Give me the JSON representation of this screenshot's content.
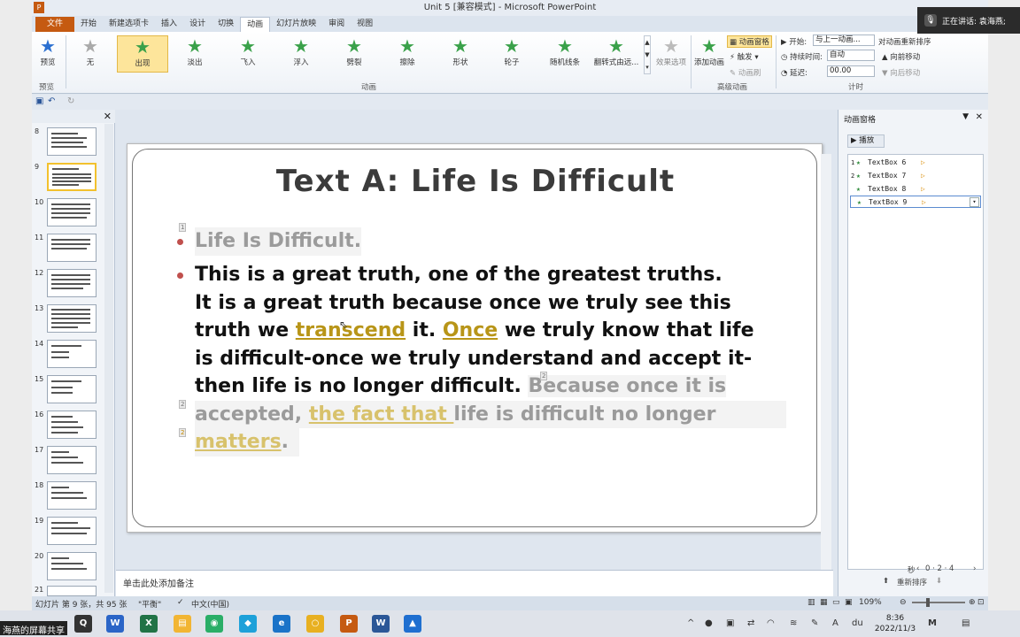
{
  "window": {
    "title": "Unit 5 [兼容模式] - Microsoft PowerPoint",
    "share_status": "正在讲话: 袁海燕;"
  },
  "tabs": [
    {
      "label": "文件"
    },
    {
      "label": "开始"
    },
    {
      "label": "新建选项卡"
    },
    {
      "label": "插入"
    },
    {
      "label": "设计"
    },
    {
      "label": "切换"
    },
    {
      "label": "动画"
    },
    {
      "label": "幻灯片放映"
    },
    {
      "label": "审阅"
    },
    {
      "label": "视图"
    }
  ],
  "ribbon": {
    "preview_label": "预览",
    "preview_group": "预览",
    "animation_group": "动画",
    "effects": [
      {
        "label": "无"
      },
      {
        "label": "出现"
      },
      {
        "label": "淡出"
      },
      {
        "label": "飞入"
      },
      {
        "label": "浮入"
      },
      {
        "label": "劈裂"
      },
      {
        "label": "擦除"
      },
      {
        "label": "形状"
      },
      {
        "label": "轮子"
      },
      {
        "label": "随机线条"
      },
      {
        "label": "翻转式由远..."
      }
    ],
    "effect_options": "效果选项",
    "add_animation": "添加动画",
    "animation_pane": "动画窗格",
    "trigger": "触发",
    "animation_painter": "动画刷",
    "advanced_group": "高级动画",
    "start_label": "开始:",
    "start_value": "与上一动画...",
    "duration_label": "持续时间:",
    "duration_value": "自动",
    "delay_label": "延迟:",
    "delay_value": "00.00",
    "reorder_title": "对动画重新排序",
    "move_earlier": "向前移动",
    "move_later": "向后移动",
    "timing_group": "计时"
  },
  "thumbnails": [
    {
      "num": "8"
    },
    {
      "num": "9"
    },
    {
      "num": "10"
    },
    {
      "num": "11"
    },
    {
      "num": "12"
    },
    {
      "num": "13"
    },
    {
      "num": "14"
    },
    {
      "num": "15"
    },
    {
      "num": "16"
    },
    {
      "num": "17"
    },
    {
      "num": "18"
    },
    {
      "num": "19"
    },
    {
      "num": "20"
    },
    {
      "num": "21"
    }
  ],
  "slide": {
    "title": "Text A: Life Is Difficult",
    "tag1": "1",
    "tag2": "2",
    "tag3": "2",
    "tag4": "2",
    "para1": "Life Is Difficult.",
    "p2_l1": "This is a great truth, one of the greatest truths.",
    "p2_l2": "It is a great truth because once we truly see this",
    "p2_l3a": "truth we ",
    "p2_l3b": "transcend",
    "p2_l3c": " it. ",
    "p2_l3d": "Once",
    "p2_l3e": " we truly know that life",
    "p2_l4": "is difficult-once we truly understand and accept it-",
    "p2_l5a": "then life is no longer difficult. ",
    "p2_l5b": "Because once it is",
    "p2_l6a": "accepted, ",
    "p2_l6b": "the fact that ",
    "p2_l6c": "life is difficult no longer",
    "p2_l7a": "matters",
    "p2_l7b": "."
  },
  "notes": {
    "placeholder": "单击此处添加备注"
  },
  "anim_pane": {
    "title": "动画窗格",
    "play": "播放",
    "items": [
      {
        "num": "1",
        "name": "TextBox 6"
      },
      {
        "num": "2",
        "name": "TextBox 7"
      },
      {
        "num": "",
        "name": "TextBox 8"
      },
      {
        "num": "",
        "name": "TextBox 9"
      }
    ],
    "seconds_label": "秒",
    "ticks": "0 · 2 · 4",
    "reorder": "重新排序"
  },
  "status": {
    "slide_info": "幻灯片 第 9 张，共 95 张",
    "theme": "\"平衡\"",
    "language": "中文(中国)",
    "zoom": "109%"
  },
  "taskbar": {
    "share_label": "海燕的屏幕共享",
    "time": "8:36",
    "date": "2022/11/3"
  }
}
